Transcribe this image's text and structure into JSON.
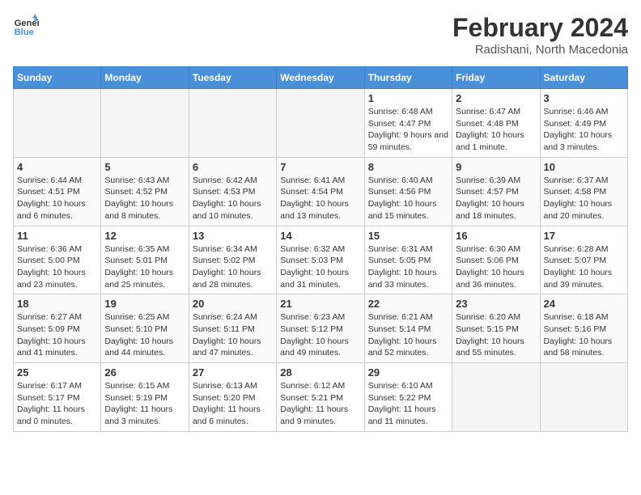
{
  "logo": {
    "line1": "General",
    "line2": "Blue"
  },
  "header": {
    "month_year": "February 2024",
    "location": "Radishani, North Macedonia"
  },
  "days_of_week": [
    "Sunday",
    "Monday",
    "Tuesday",
    "Wednesday",
    "Thursday",
    "Friday",
    "Saturday"
  ],
  "weeks": [
    [
      {
        "day": "",
        "info": ""
      },
      {
        "day": "",
        "info": ""
      },
      {
        "day": "",
        "info": ""
      },
      {
        "day": "",
        "info": ""
      },
      {
        "day": "1",
        "info": "Sunrise: 6:48 AM\nSunset: 4:47 PM\nDaylight: 9 hours and 59 minutes."
      },
      {
        "day": "2",
        "info": "Sunrise: 6:47 AM\nSunset: 4:48 PM\nDaylight: 10 hours and 1 minute."
      },
      {
        "day": "3",
        "info": "Sunrise: 6:46 AM\nSunset: 4:49 PM\nDaylight: 10 hours and 3 minutes."
      }
    ],
    [
      {
        "day": "4",
        "info": "Sunrise: 6:44 AM\nSunset: 4:51 PM\nDaylight: 10 hours and 6 minutes."
      },
      {
        "day": "5",
        "info": "Sunrise: 6:43 AM\nSunset: 4:52 PM\nDaylight: 10 hours and 8 minutes."
      },
      {
        "day": "6",
        "info": "Sunrise: 6:42 AM\nSunset: 4:53 PM\nDaylight: 10 hours and 10 minutes."
      },
      {
        "day": "7",
        "info": "Sunrise: 6:41 AM\nSunset: 4:54 PM\nDaylight: 10 hours and 13 minutes."
      },
      {
        "day": "8",
        "info": "Sunrise: 6:40 AM\nSunset: 4:56 PM\nDaylight: 10 hours and 15 minutes."
      },
      {
        "day": "9",
        "info": "Sunrise: 6:39 AM\nSunset: 4:57 PM\nDaylight: 10 hours and 18 minutes."
      },
      {
        "day": "10",
        "info": "Sunrise: 6:37 AM\nSunset: 4:58 PM\nDaylight: 10 hours and 20 minutes."
      }
    ],
    [
      {
        "day": "11",
        "info": "Sunrise: 6:36 AM\nSunset: 5:00 PM\nDaylight: 10 hours and 23 minutes."
      },
      {
        "day": "12",
        "info": "Sunrise: 6:35 AM\nSunset: 5:01 PM\nDaylight: 10 hours and 25 minutes."
      },
      {
        "day": "13",
        "info": "Sunrise: 6:34 AM\nSunset: 5:02 PM\nDaylight: 10 hours and 28 minutes."
      },
      {
        "day": "14",
        "info": "Sunrise: 6:32 AM\nSunset: 5:03 PM\nDaylight: 10 hours and 31 minutes."
      },
      {
        "day": "15",
        "info": "Sunrise: 6:31 AM\nSunset: 5:05 PM\nDaylight: 10 hours and 33 minutes."
      },
      {
        "day": "16",
        "info": "Sunrise: 6:30 AM\nSunset: 5:06 PM\nDaylight: 10 hours and 36 minutes."
      },
      {
        "day": "17",
        "info": "Sunrise: 6:28 AM\nSunset: 5:07 PM\nDaylight: 10 hours and 39 minutes."
      }
    ],
    [
      {
        "day": "18",
        "info": "Sunrise: 6:27 AM\nSunset: 5:09 PM\nDaylight: 10 hours and 41 minutes."
      },
      {
        "day": "19",
        "info": "Sunrise: 6:25 AM\nSunset: 5:10 PM\nDaylight: 10 hours and 44 minutes."
      },
      {
        "day": "20",
        "info": "Sunrise: 6:24 AM\nSunset: 5:11 PM\nDaylight: 10 hours and 47 minutes."
      },
      {
        "day": "21",
        "info": "Sunrise: 6:23 AM\nSunset: 5:12 PM\nDaylight: 10 hours and 49 minutes."
      },
      {
        "day": "22",
        "info": "Sunrise: 6:21 AM\nSunset: 5:14 PM\nDaylight: 10 hours and 52 minutes."
      },
      {
        "day": "23",
        "info": "Sunrise: 6:20 AM\nSunset: 5:15 PM\nDaylight: 10 hours and 55 minutes."
      },
      {
        "day": "24",
        "info": "Sunrise: 6:18 AM\nSunset: 5:16 PM\nDaylight: 10 hours and 58 minutes."
      }
    ],
    [
      {
        "day": "25",
        "info": "Sunrise: 6:17 AM\nSunset: 5:17 PM\nDaylight: 11 hours and 0 minutes."
      },
      {
        "day": "26",
        "info": "Sunrise: 6:15 AM\nSunset: 5:19 PM\nDaylight: 11 hours and 3 minutes."
      },
      {
        "day": "27",
        "info": "Sunrise: 6:13 AM\nSunset: 5:20 PM\nDaylight: 11 hours and 6 minutes."
      },
      {
        "day": "28",
        "info": "Sunrise: 6:12 AM\nSunset: 5:21 PM\nDaylight: 11 hours and 9 minutes."
      },
      {
        "day": "29",
        "info": "Sunrise: 6:10 AM\nSunset: 5:22 PM\nDaylight: 11 hours and 11 minutes."
      },
      {
        "day": "",
        "info": ""
      },
      {
        "day": "",
        "info": ""
      }
    ]
  ]
}
